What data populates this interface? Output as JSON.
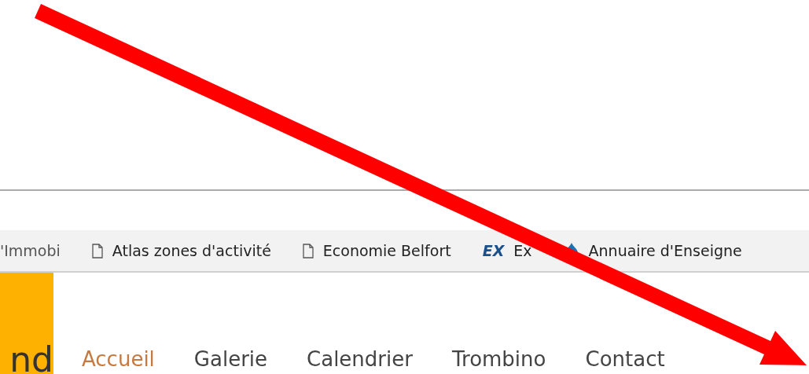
{
  "bookmarks": [
    {
      "label": "'Immobi",
      "kind": "plain"
    },
    {
      "label": "Atlas zones d'activité",
      "kind": "page"
    },
    {
      "label": "Economie Belfort",
      "kind": "page"
    },
    {
      "label": "Ex",
      "kind": "logo",
      "logo_text": "EX"
    },
    {
      "label": "Annuaire d'Enseigne",
      "kind": "drop"
    }
  ],
  "site": {
    "logo_text": "nd"
  },
  "nav": [
    {
      "label": "Accueil",
      "selected": true
    },
    {
      "label": "Galerie",
      "selected": false
    },
    {
      "label": "Calendrier",
      "selected": false
    },
    {
      "label": "Trombino",
      "selected": false
    },
    {
      "label": "Contact",
      "selected": false
    }
  ]
}
